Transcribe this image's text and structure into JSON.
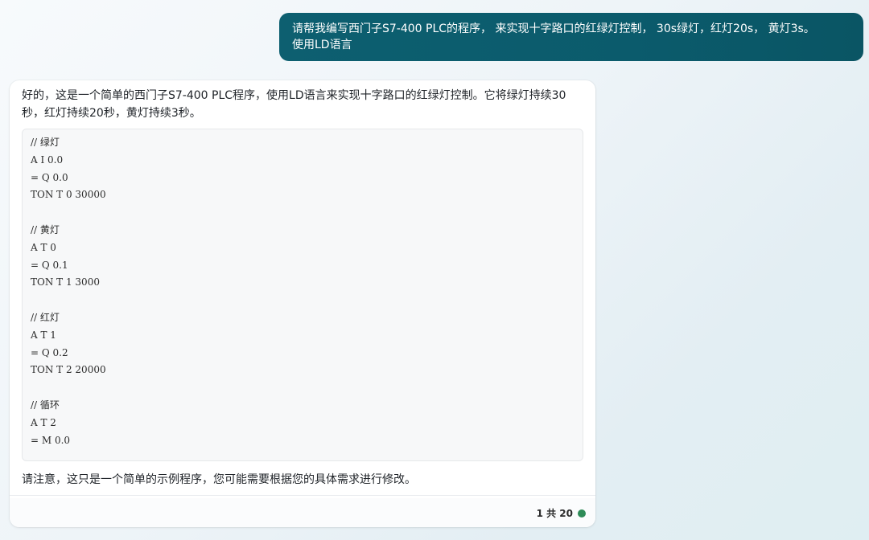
{
  "chat": {
    "user_message": {
      "line1": "请帮我编写西门子S7-400 PLC的程序， 来实现十字路口的红绿灯控制， 30s绿灯，红灯20s， 黄灯3s。",
      "line2": "使用LD语言"
    },
    "assistant_message": {
      "intro": "好的，这是一个简单的西门子S7-400 PLC程序，使用LD语言来实现十字路口的红绿灯控制。它将绿灯持续30秒，红灯持续20秒，黄灯持续3秒。",
      "code_lines": [
        "// 绿灯",
        "A I 0.0",
        "= Q 0.0",
        "TON T 0 30000",
        "",
        "// 黄灯",
        "A T 0",
        "= Q 0.1",
        "TON T 1 3000",
        "",
        "// 红灯",
        "A T 1",
        "= Q 0.2",
        "TON T 2 20000",
        "",
        "// 循环",
        "A T 2",
        "= M 0.0"
      ],
      "note": "请注意，这只是一个简单的示例程序，您可能需要根据您的具体需求进行修改。"
    },
    "pager": {
      "text": "1 共 20"
    }
  },
  "colors": {
    "user_bubble": "#0b5b6c",
    "status_dot": "#2e8b57"
  }
}
